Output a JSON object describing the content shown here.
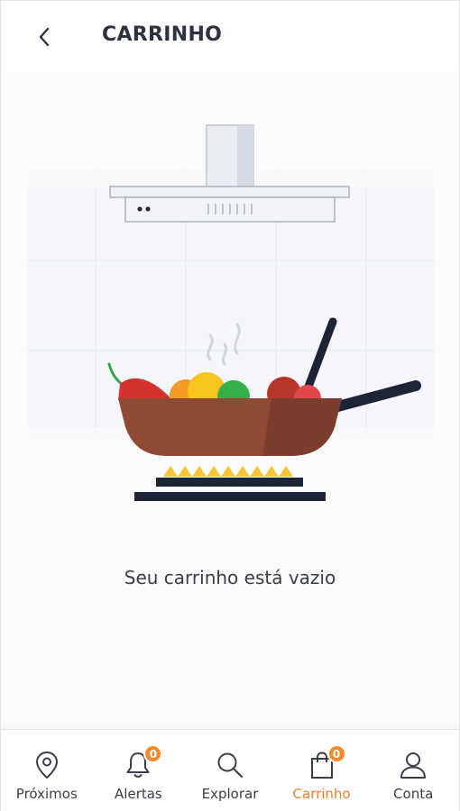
{
  "header": {
    "title": "CARRINHO"
  },
  "cart": {
    "empty_message": "Seu carrinho está vazio"
  },
  "tabbar": {
    "tabs": [
      {
        "label": "Próximos",
        "icon": "location-pin-icon"
      },
      {
        "label": "Alertas",
        "icon": "bell-icon",
        "badge": "0"
      },
      {
        "label": "Explorar",
        "icon": "search-icon"
      },
      {
        "label": "Carrinho",
        "icon": "shopping-bag-icon",
        "badge": "0",
        "active": true
      },
      {
        "label": "Conta",
        "icon": "user-icon"
      }
    ]
  },
  "colors": {
    "accent": "#f07d2a",
    "badge": "#f58a2b",
    "text": "#2d3240",
    "pan": "#8f4a35",
    "navy": "#1e2438"
  }
}
